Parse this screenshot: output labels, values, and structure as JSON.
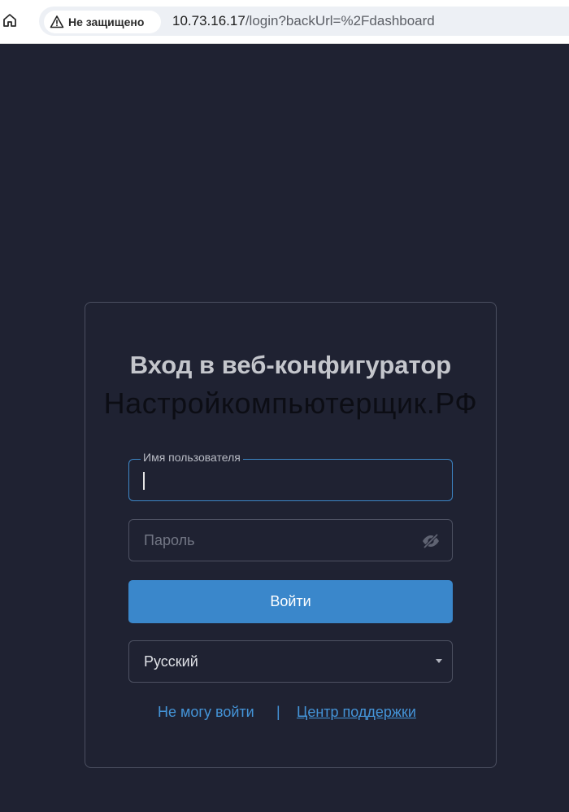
{
  "browser": {
    "security_label": "Не защищено",
    "url_host": "10.73.16.17",
    "url_path": "/login?backUrl=%2Fdashboard"
  },
  "login": {
    "title": "Вход в веб-конфигуратор",
    "watermark": "Настройкомпьютерщик.РФ",
    "username_label": "Имя пользователя",
    "username_value": "",
    "password_placeholder": "Пароль",
    "submit_label": "Войти",
    "language_value": "Русский",
    "link_cant_login": "Не могу войти",
    "separator": "|",
    "link_support": "Центр поддержки"
  },
  "colors": {
    "page_bg": "#1f2232",
    "accent": "#3a87cb",
    "link": "#4494d8"
  }
}
